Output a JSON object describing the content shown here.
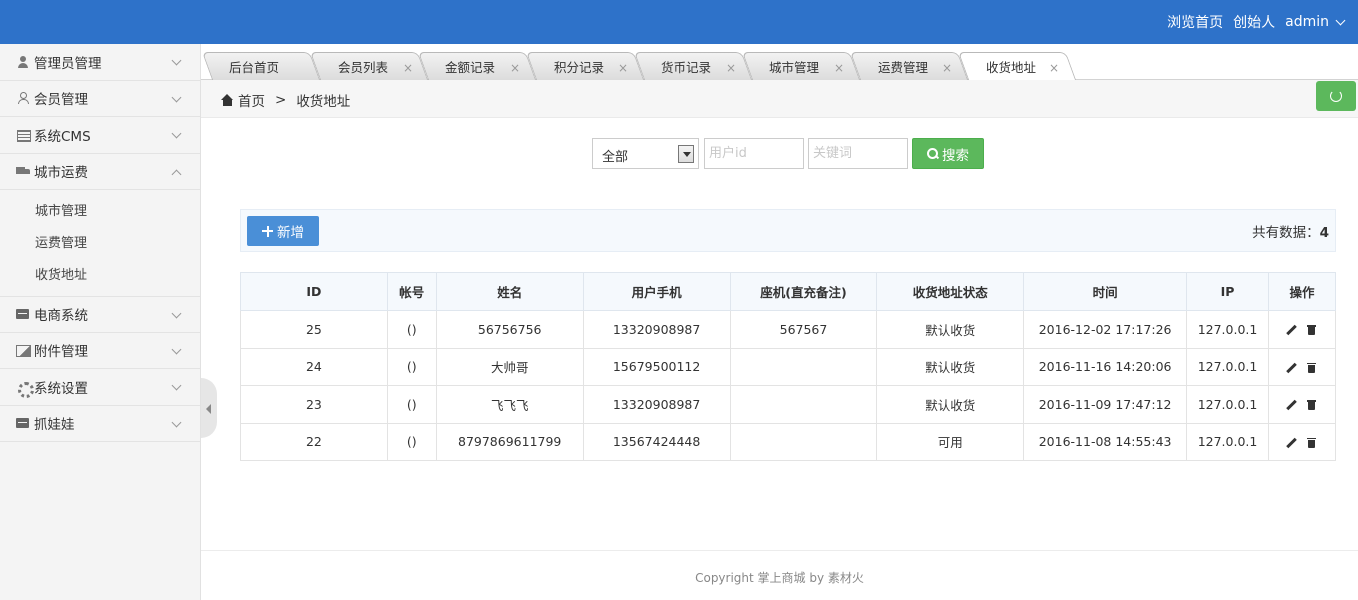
{
  "header": {
    "links": [
      "浏览首页",
      "创始人"
    ],
    "user": "admin",
    "bg_color": "#2e72c9"
  },
  "sidebar": {
    "items": [
      {
        "label": "管理员管理",
        "icon": "user-icon",
        "expanded": false
      },
      {
        "label": "会员管理",
        "icon": "user-outline-icon",
        "expanded": false
      },
      {
        "label": "系统CMS",
        "icon": "document-icon",
        "expanded": false
      },
      {
        "label": "城市运费",
        "icon": "truck-icon",
        "expanded": true,
        "children": [
          "城市管理",
          "运费管理",
          "收货地址"
        ]
      },
      {
        "label": "电商系统",
        "icon": "card-icon",
        "expanded": false
      },
      {
        "label": "附件管理",
        "icon": "picture-icon",
        "expanded": false
      },
      {
        "label": "系统设置",
        "icon": "gear-icon",
        "expanded": false
      },
      {
        "label": "抓娃娃",
        "icon": "card-icon",
        "expanded": false
      }
    ]
  },
  "tabs": [
    {
      "label": "后台首页",
      "closable": false
    },
    {
      "label": "会员列表",
      "closable": true
    },
    {
      "label": "金额记录",
      "closable": true
    },
    {
      "label": "积分记录",
      "closable": true
    },
    {
      "label": "货币记录",
      "closable": true
    },
    {
      "label": "城市管理",
      "closable": true
    },
    {
      "label": "运费管理",
      "closable": true
    },
    {
      "label": "收货地址",
      "closable": true,
      "active": true
    }
  ],
  "breadcrumb": {
    "home": "首页",
    "separator": ">",
    "current": "收货地址"
  },
  "search": {
    "select_value": "全部",
    "user_id_placeholder": "用户id",
    "keyword_placeholder": "关键词",
    "button_label": "搜索"
  },
  "actions": {
    "add_label": "新增",
    "count_label": "共有数据：",
    "count_value": "4"
  },
  "table": {
    "headers": [
      "ID",
      "帐号",
      "姓名",
      "用户手机",
      "座机(直充备注)",
      "收货地址状态",
      "时间",
      "IP",
      "操作"
    ],
    "rows": [
      {
        "id": "25",
        "account": "()",
        "name": "56756756",
        "phone": "13320908987",
        "landline": "567567",
        "status": "默认收货",
        "time": "2016-12-02 17:17:26",
        "ip": "127.0.0.1"
      },
      {
        "id": "24",
        "account": "()",
        "name": "大帅哥",
        "phone": "15679500112",
        "landline": "",
        "status": "默认收货",
        "time": "2016-11-16 14:20:06",
        "ip": "127.0.0.1"
      },
      {
        "id": "23",
        "account": "()",
        "name": "飞飞飞",
        "phone": "13320908987",
        "landline": "",
        "status": "默认收货",
        "time": "2016-11-09 17:47:12",
        "ip": "127.0.0.1"
      },
      {
        "id": "22",
        "account": "()",
        "name": "8797869611799",
        "phone": "13567424448",
        "landline": "",
        "status": "可用",
        "time": "2016-11-08 14:55:43",
        "ip": "127.0.0.1"
      }
    ]
  },
  "footer": {
    "text": "Copyright 掌上商城 by 素材火"
  }
}
